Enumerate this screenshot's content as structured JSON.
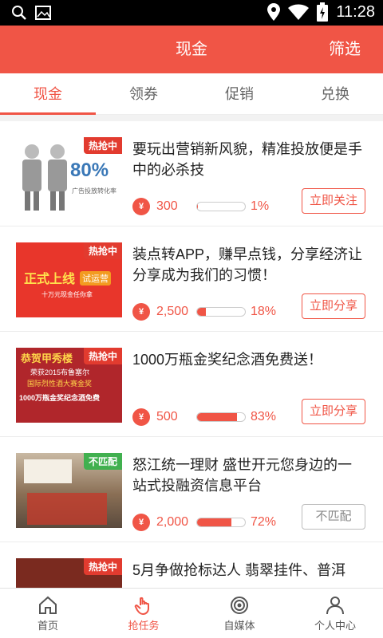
{
  "status_bar": {
    "time": "11:28"
  },
  "header": {
    "title": "现金",
    "filter_label": "筛选"
  },
  "tabs": [
    {
      "label": "现金",
      "active": true
    },
    {
      "label": "领券",
      "active": false
    },
    {
      "label": "促销",
      "active": false
    },
    {
      "label": "兑换",
      "active": false
    }
  ],
  "items": [
    {
      "tag": "热抢中",
      "tag_color": "#e23b2f",
      "title": "要玩出营销新风貌，精准投放便是手中的必杀技",
      "reward_icon": "¥",
      "reward": "300",
      "progress_percent": 1,
      "progress_text": "1%",
      "button": "立即关注",
      "button_enabled": true,
      "thumb": {
        "big_text": "80%",
        "small_text": "广告投放转化率"
      }
    },
    {
      "tag": "热抢中",
      "tag_color": "#e23b2f",
      "title": "装点转APP，赚早点钱，分享经济让分享成为我们的习惯！",
      "reward_icon": "¥",
      "reward": "2,500",
      "progress_percent": 18,
      "progress_text": "18%",
      "button": "立即分享",
      "button_enabled": true,
      "thumb": {
        "line1": "正式上线",
        "line2": "试运营",
        "line3": "十万元现金任你拿"
      }
    },
    {
      "tag": "热抢中",
      "tag_color": "#e23b2f",
      "title": "1000万瓶金奖纪念酒免费送！",
      "reward_icon": "¥",
      "reward": "500",
      "progress_percent": 83,
      "progress_text": "83%",
      "button": "立即分享",
      "button_enabled": true,
      "thumb": {
        "line1": "恭贺甲秀楼",
        "line2": "荣获2015布鲁塞尔",
        "line3": "国际烈性酒大赛金奖",
        "line4": "1000万瓶金奖纪念酒免费"
      }
    },
    {
      "tag": "不匹配",
      "tag_color": "#41b04f",
      "title": "怒江统一理财 盛世开元您身边的一站式投融资信息平台",
      "reward_icon": "¥",
      "reward": "2,000",
      "progress_percent": 72,
      "progress_text": "72%",
      "button": "不匹配",
      "button_enabled": false,
      "thumb": {}
    },
    {
      "tag": "热抢中",
      "tag_color": "#e23b2f",
      "title": "5月争做抢标达人 翡翠挂件、普洱",
      "reward_icon": "¥",
      "reward": "",
      "progress_percent": 0,
      "progress_text": "",
      "button": "",
      "button_enabled": true,
      "thumb": {}
    }
  ],
  "bottom_nav": [
    {
      "label": "首页",
      "icon": "home-icon",
      "active": false
    },
    {
      "label": "抢任务",
      "icon": "hand-tap-icon",
      "active": true
    },
    {
      "label": "自媒体",
      "icon": "broadcast-icon",
      "active": false
    },
    {
      "label": "个人中心",
      "icon": "person-icon",
      "active": false
    }
  ],
  "colors": {
    "brand": "#f05546",
    "tag_green": "#41b04f"
  }
}
